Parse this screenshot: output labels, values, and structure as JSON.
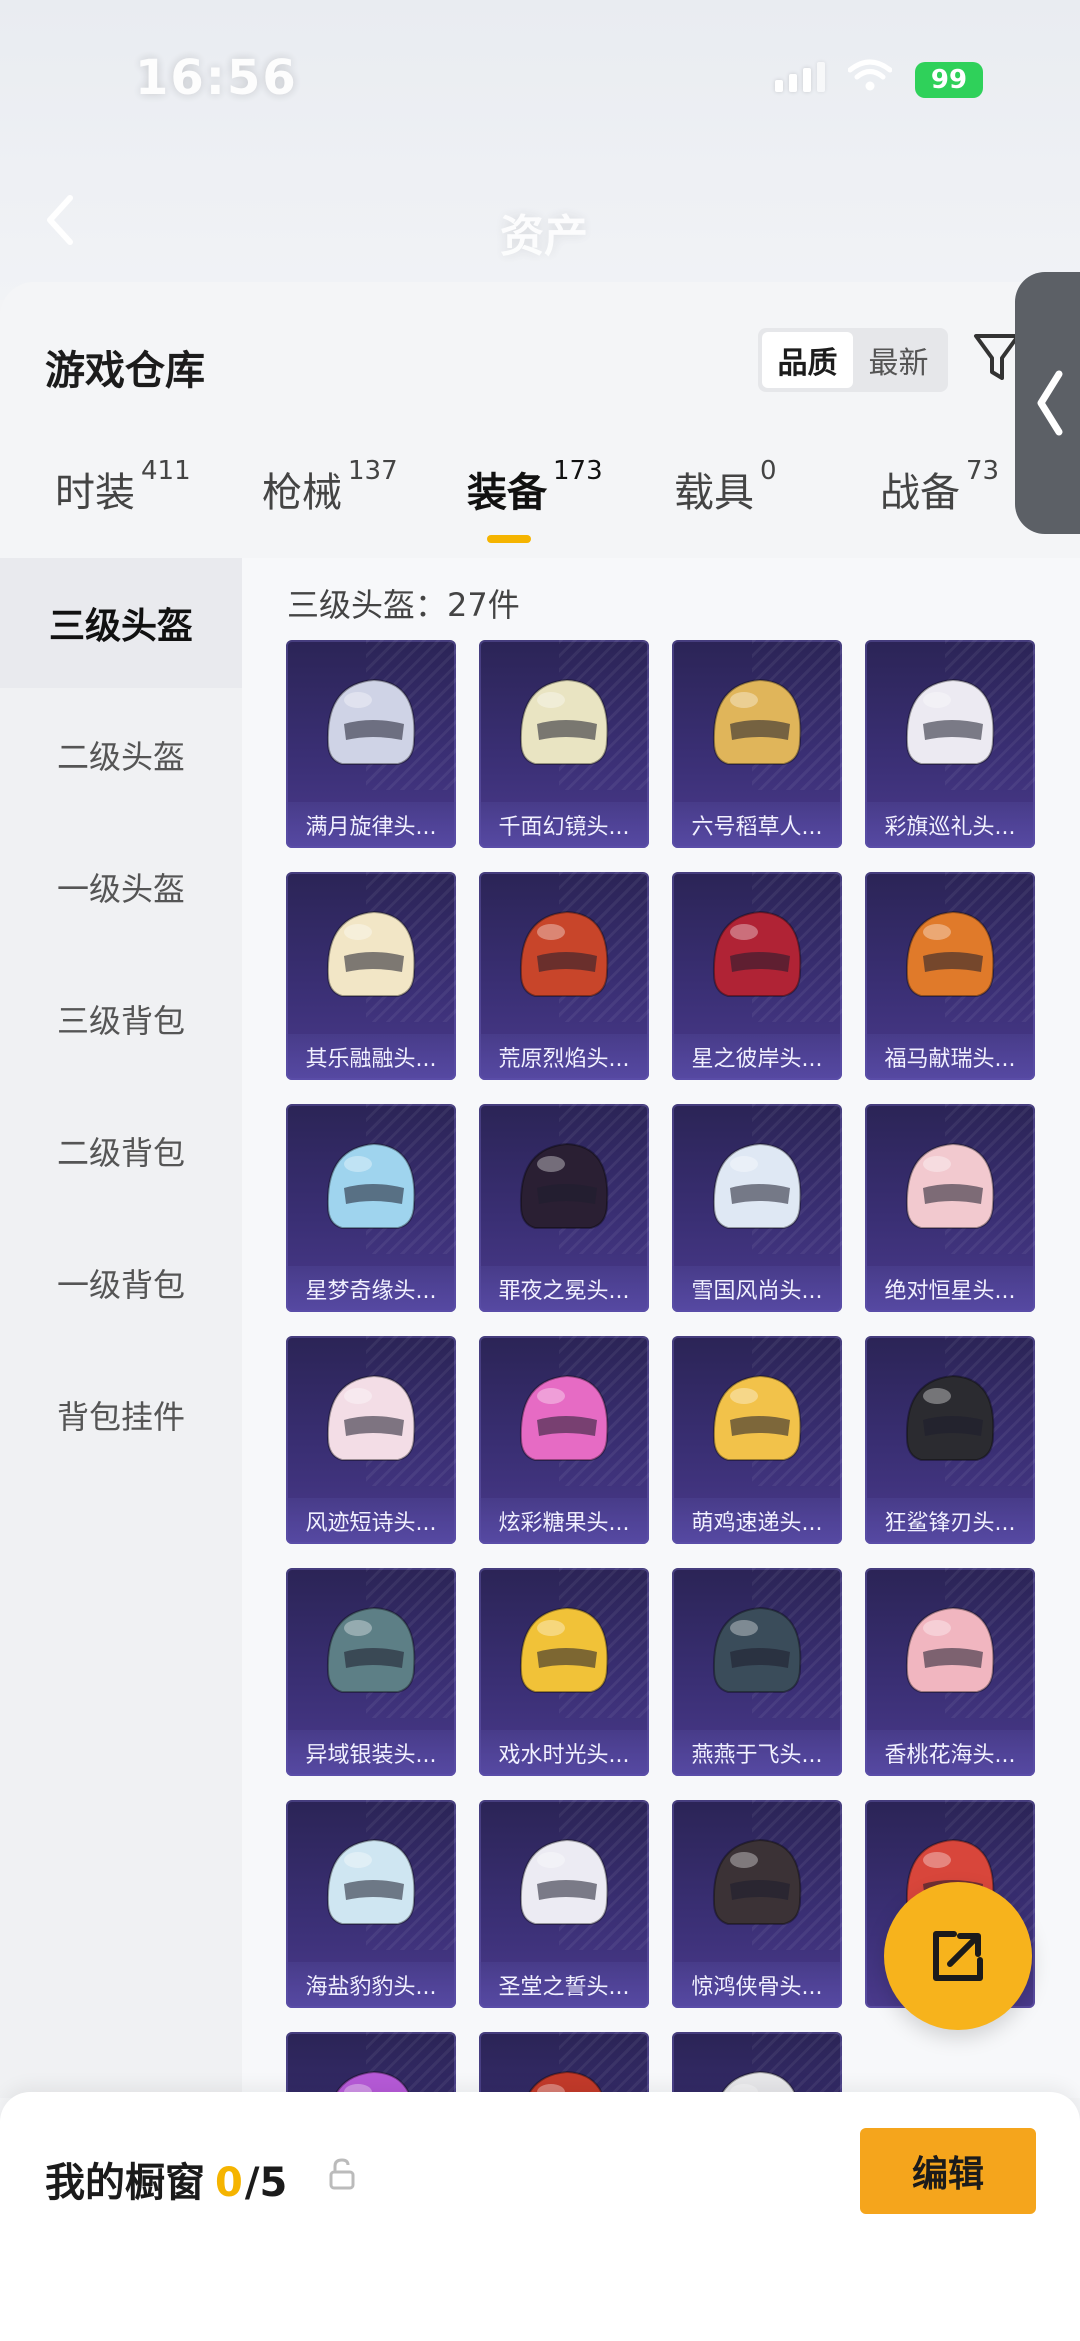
{
  "status_bar": {
    "time": "16:56",
    "battery": "99"
  },
  "header": {
    "title": "资产"
  },
  "warehouse": {
    "title": "游戏仓库",
    "sort_options": [
      "品质",
      "最新"
    ]
  },
  "tabs": [
    {
      "label": "时装",
      "count": "411"
    },
    {
      "label": "枪械",
      "count": "137"
    },
    {
      "label": "装备",
      "count": "173"
    },
    {
      "label": "载具",
      "count": "0"
    },
    {
      "label": "战备",
      "count": "73"
    }
  ],
  "sidebar": [
    "三级头盔",
    "二级头盔",
    "一级头盔",
    "三级背包",
    "二级背包",
    "一级背包",
    "背包挂件"
  ],
  "section": {
    "title": "三级头盔：27件"
  },
  "items": [
    {
      "name": "满月旋律头...",
      "color": "#cfd3e6"
    },
    {
      "name": "千面幻镜头...",
      "color": "#e9e4c2"
    },
    {
      "name": "六号稻草人...",
      "color": "#e0b55a"
    },
    {
      "name": "彩旗巡礼头...",
      "color": "#eceaf2"
    },
    {
      "name": "其乐融融头...",
      "color": "#f2e6c6"
    },
    {
      "name": "荒原烈焰头...",
      "color": "#c8452a"
    },
    {
      "name": "星之彼岸头...",
      "color": "#b02335"
    },
    {
      "name": "福马献瑞头...",
      "color": "#e07a2a"
    },
    {
      "name": "星梦奇缘头...",
      "color": "#9fd4ee"
    },
    {
      "name": "罪夜之冕头...",
      "color": "#2a1f33"
    },
    {
      "name": "雪国风尚头...",
      "color": "#dfe8f4"
    },
    {
      "name": "绝对恒星头...",
      "color": "#f2c9cf"
    },
    {
      "name": "风迹短诗头...",
      "color": "#f3dde6"
    },
    {
      "name": "炫彩糖果头...",
      "color": "#e66bc4"
    },
    {
      "name": "萌鸡速递头...",
      "color": "#f2c24a"
    },
    {
      "name": "狂鲨锋刃头...",
      "color": "#2b2b30"
    },
    {
      "name": "异域银装头...",
      "color": "#5d7f86"
    },
    {
      "name": "戏水时光头...",
      "color": "#f1c238"
    },
    {
      "name": "燕燕于飞头...",
      "color": "#3a4c5a"
    },
    {
      "name": "香桃花海头...",
      "color": "#f1b6c0"
    },
    {
      "name": "海盐豹豹头...",
      "color": "#cfe6f2"
    },
    {
      "name": "圣堂之誓头...",
      "color": "#ecebf3"
    },
    {
      "name": "惊鸿侠骨头...",
      "color": "#3b3236"
    },
    {
      "name": "",
      "color": "#d8463b"
    },
    {
      "name": "",
      "color": "#b65ad8"
    },
    {
      "name": "",
      "color": "#c33a2a"
    },
    {
      "name": "",
      "color": "#e7e7ea"
    }
  ],
  "showcase": {
    "label": "我的橱窗",
    "current": "0",
    "total": "/5",
    "edit_label": "编辑"
  }
}
